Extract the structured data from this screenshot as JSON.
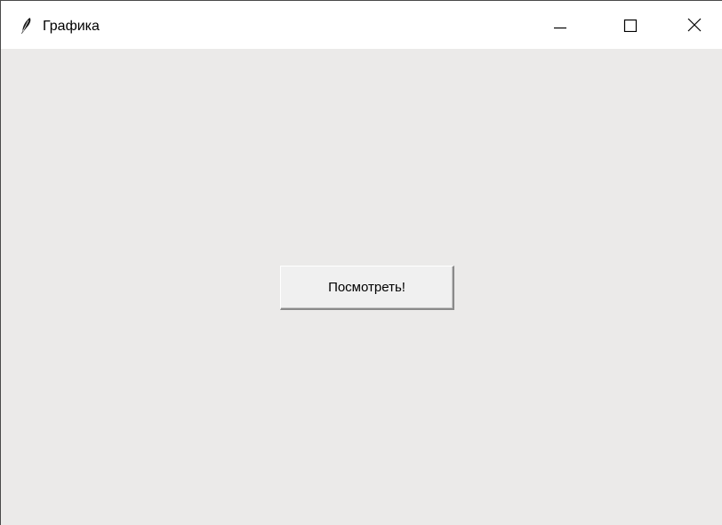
{
  "window": {
    "title": "Графика",
    "app_icon": "feather-icon",
    "controls": {
      "minimize_icon": "minimize-icon",
      "maximize_icon": "maximize-icon",
      "close_icon": "close-icon"
    }
  },
  "main": {
    "button_label": "Посмотреть!"
  },
  "colors": {
    "titlebar_bg": "#ffffff",
    "client_bg": "#ebeae9",
    "button_bg": "#f0f0f0",
    "text": "#000000"
  }
}
